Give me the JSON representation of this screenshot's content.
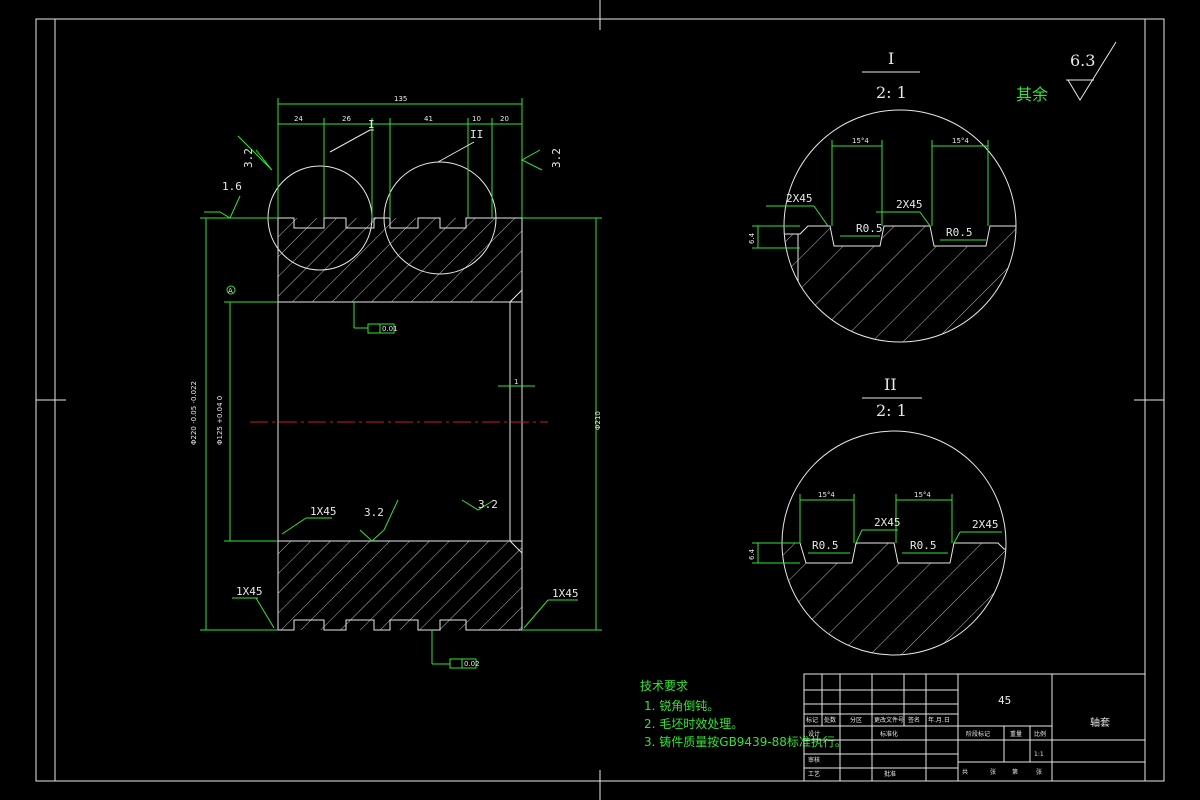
{
  "colors": {
    "background": "#000000",
    "outline": "#e8e8e8",
    "dimension": "#2fe62f",
    "centerline": "#c81e1e"
  },
  "main_view": {
    "dims_top": [
      "135",
      "24",
      "26",
      "41",
      "10",
      "20"
    ],
    "dims_left": [
      "Φ220 -0.05 -0.022",
      "Φ125 +0.04 0"
    ],
    "dim_right": "Φ210",
    "roughness_labels": [
      "3.2",
      "3.2",
      "1.6",
      "3.2",
      "3.2"
    ],
    "chamfer_labels": [
      "1X45",
      "1X45",
      "1X45"
    ],
    "detail_markers": [
      "I",
      "II"
    ],
    "datum": "A",
    "tol_frames": [
      "0.01",
      "0.02"
    ],
    "small_dim": "1"
  },
  "detail_1": {
    "title": "I",
    "scale": "2: 1",
    "angle_labels": [
      "15°4",
      "15°4"
    ],
    "chamfers": [
      "2X45",
      "2X45"
    ],
    "radii": [
      "R0.5",
      "R0.5"
    ],
    "depth": "6.4"
  },
  "detail_2": {
    "title": "II",
    "scale": "2: 1",
    "angle_labels": [
      "15°4",
      "15°4"
    ],
    "chamfers": [
      "2X45",
      "2X45"
    ],
    "radii": [
      "R0.5",
      "R0.5"
    ],
    "depth": "6.4"
  },
  "roughness_rest": {
    "label": "其余",
    "value": "6.3"
  },
  "tech_requirements": {
    "heading": "技术要求",
    "items": [
      "1. 锐角倒钝。",
      "2. 毛坯时效处理。",
      "3. 铸件质量按GB9439-88标准执行。"
    ]
  },
  "title_block": {
    "material": "45",
    "part_name": "轴套",
    "scale": "1:1",
    "header_cells": [
      "标记",
      "处数",
      "分区",
      "更改文件号",
      "签名",
      "年.月.日"
    ],
    "row_labels": [
      "设计",
      "审核",
      "工艺"
    ],
    "std_label": "标准化",
    "approve_label": "批准",
    "stage_label": "阶段标记",
    "weight_label": "重量",
    "scale_label": "比例",
    "sheet_labels": [
      "共",
      "张",
      "第",
      "张"
    ]
  }
}
